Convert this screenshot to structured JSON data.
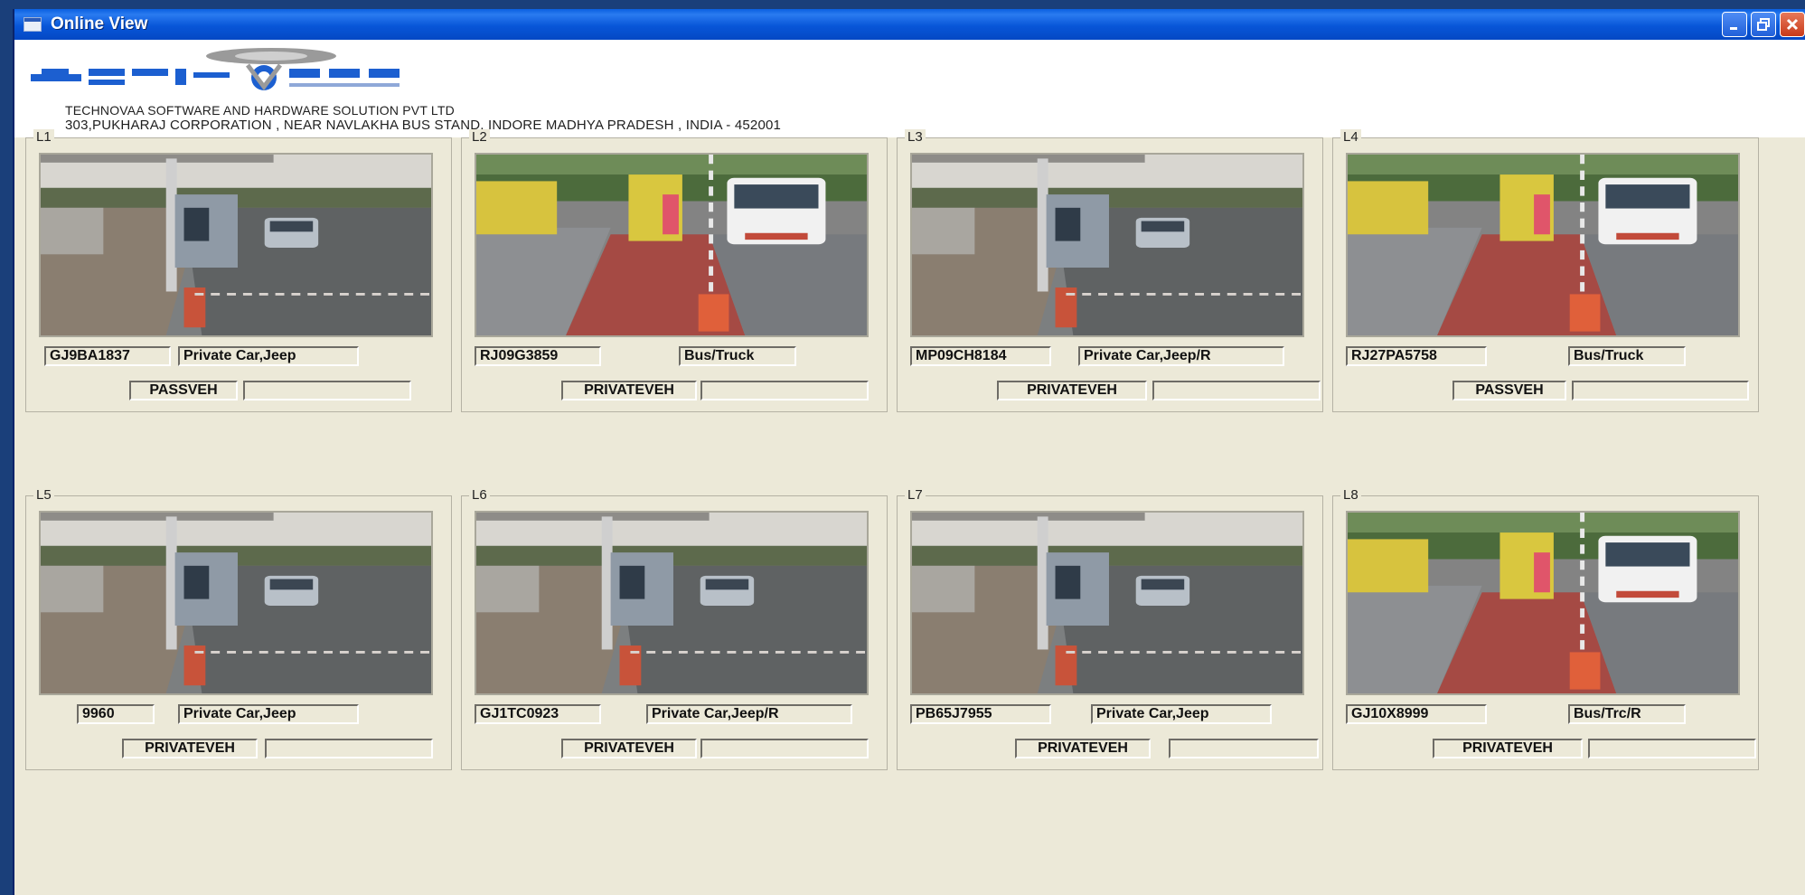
{
  "window": {
    "title": "Online View",
    "controls": [
      "minimize",
      "restore",
      "close"
    ]
  },
  "company": {
    "logo_text": "TECHNOVAA",
    "logo_subtext": "KNOWLEDGE",
    "name": "TECHNOVAA SOFTWARE AND HARDWARE SOLUTION PVT LTD",
    "address": "303,PUKHARAJ CORPORATION , NEAR NAVLAKHA BUS STAND, INDORE MADHYA PRADESH , INDIA - 452001"
  },
  "lanes": [
    {
      "label": "L1",
      "plate": "GJ9BA1837",
      "vehicle_class": "Private Car,Jeep",
      "category": "PASSVEH",
      "extra": ""
    },
    {
      "label": "L2",
      "plate": "RJ09G3859",
      "vehicle_class": "Bus/Truck",
      "category": "PRIVATEVEH",
      "extra": ""
    },
    {
      "label": "L3",
      "plate": "MP09CH8184",
      "vehicle_class": "Private Car,Jeep/R",
      "category": "PRIVATEVEH",
      "extra": ""
    },
    {
      "label": "L4",
      "plate": "RJ27PA5758",
      "vehicle_class": "Bus/Truck",
      "category": "PASSVEH",
      "extra": ""
    },
    {
      "label": "L5",
      "plate": "9960",
      "vehicle_class": "Private Car,Jeep",
      "category": "PRIVATEVEH",
      "extra": ""
    },
    {
      "label": "L6",
      "plate": "GJ1TC0923",
      "vehicle_class": "Private Car,Jeep/R",
      "category": "PRIVATEVEH",
      "extra": ""
    },
    {
      "label": "L7",
      "plate": "PB65J7955",
      "vehicle_class": "Private Car,Jeep",
      "category": "PRIVATEVEH",
      "extra": ""
    },
    {
      "label": "L8",
      "plate": "GJ10X8999",
      "vehicle_class": "Bus/Trc/R",
      "category": "PRIVATEVEH",
      "extra": ""
    }
  ]
}
